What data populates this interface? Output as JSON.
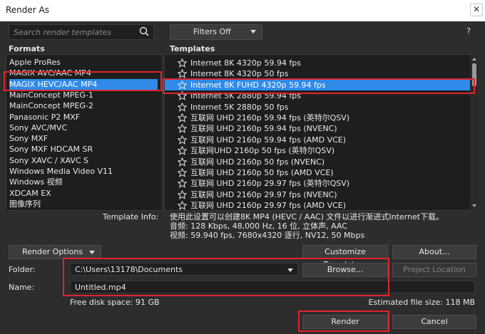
{
  "window": {
    "title": "Render As",
    "close_glyph": "✕"
  },
  "search": {
    "placeholder": "Search render templates"
  },
  "filters": {
    "label": "Filters Off"
  },
  "help": {
    "label": "?"
  },
  "formats": {
    "header": "Formats",
    "items": [
      {
        "label": "Apple ProRes",
        "selected": false
      },
      {
        "label": "MAGIX AVC/AAC MP4",
        "selected": false
      },
      {
        "label": "MAGIX HEVC/AAC MP4",
        "selected": true
      },
      {
        "label": "MainConcept MPEG-1",
        "selected": false
      },
      {
        "label": "MainConcept MPEG-2",
        "selected": false
      },
      {
        "label": "Panasonic P2 MXF",
        "selected": false
      },
      {
        "label": "Sony AVC/MVC",
        "selected": false
      },
      {
        "label": "Sony MXF",
        "selected": false
      },
      {
        "label": "Sony MXF HDCAM SR",
        "selected": false
      },
      {
        "label": "Sony XAVC / XAVC S",
        "selected": false
      },
      {
        "label": "Windows Media Video V11",
        "selected": false
      },
      {
        "label": "Windows 视频",
        "selected": false
      },
      {
        "label": "XDCAM EX",
        "selected": false
      },
      {
        "label": "图像序列",
        "selected": false
      }
    ]
  },
  "templates": {
    "header": "Templates",
    "items": [
      {
        "label": "Internet 8K 4320p 59.94 fps",
        "selected": false
      },
      {
        "label": "Internet 8K 4320p 50 fps",
        "selected": false
      },
      {
        "label": "Internet 8K FUHD 4320p 59.94 fps",
        "selected": true
      },
      {
        "label": "Internet 5K 2880p 59.94 fps",
        "selected": false
      },
      {
        "label": "Internet 5K 2880p 50 fps",
        "selected": false
      },
      {
        "label": "互联网 UHD 2160p 59.94 fps (英特尔QSV)",
        "selected": false
      },
      {
        "label": "互联网 UHD 2160p 59.94 fps (NVENC)",
        "selected": false
      },
      {
        "label": "互联网 UHD 2160p 59.94 fps (AMD VCE)",
        "selected": false
      },
      {
        "label": "互联网UHD 2160p 50 fps (英特尔QSV)",
        "selected": false
      },
      {
        "label": "互联网 UHD 2160p 50 fps (NVENC)",
        "selected": false
      },
      {
        "label": "互联网 UHD 2160p 50 fps (AMD VCE)",
        "selected": false
      },
      {
        "label": "互联网 UHD 2160p 29.97 fps (英特尔QSV)",
        "selected": false
      },
      {
        "label": "互联网 UHD 2160p 29.97 fps (NVENC)",
        "selected": false
      },
      {
        "label": "互联网 UHD 2160p 29.97 fps (AMD VCE)",
        "selected": false
      }
    ]
  },
  "template_info": {
    "label": "Template Info:",
    "lines": [
      "使用此设置可以创建8K MP4 (HEVC / AAC) 文件以进行渐进式Internet下载。",
      "音频: 128 Kbps, 48,000 Hz, 16 位, 立体声, AAC",
      "视频: 59.940 fps, 7680x4320 逐行, NV12, 50 Mbps"
    ]
  },
  "buttons": {
    "render_options": "Render Options",
    "customize_template": "Customize Template...",
    "about": "About...",
    "browse": "Browse...",
    "project_location": "Project Location",
    "render": "Render",
    "cancel": "Cancel"
  },
  "folder": {
    "label": "Folder:",
    "value": "C:\\Users\\13178\\Documents"
  },
  "name": {
    "label": "Name:",
    "value": "Untitled.mp4"
  },
  "disk": {
    "free": "Free disk space: 91 GB",
    "estimated": "Estimated file size: 118 MB"
  },
  "colors": {
    "selection": "#2f8ae8",
    "highlight_box": "#e0242e",
    "background": "#2d2d2d"
  }
}
